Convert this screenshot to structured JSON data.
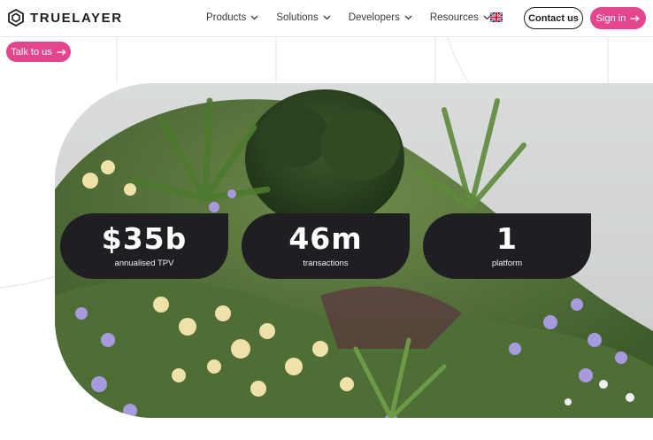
{
  "brand": {
    "name": "TRUELAYER"
  },
  "nav": {
    "items": [
      {
        "label": "Products"
      },
      {
        "label": "Solutions"
      },
      {
        "label": "Developers"
      },
      {
        "label": "Resources"
      }
    ]
  },
  "header": {
    "language_icon": "uk-flag-icon",
    "contact_label": "Contact us",
    "signin_label": "Sign in"
  },
  "hero": {
    "cta_label": "Talk to us",
    "stats": [
      {
        "value": "$35b",
        "label": "annualised TPV"
      },
      {
        "value": "46m",
        "label": "transactions"
      },
      {
        "value": "1",
        "label": "platform"
      }
    ]
  },
  "colors": {
    "accent_pink": "#e3458e",
    "dark_pill": "#1f1e22",
    "text_dark": "#1d1d20"
  }
}
